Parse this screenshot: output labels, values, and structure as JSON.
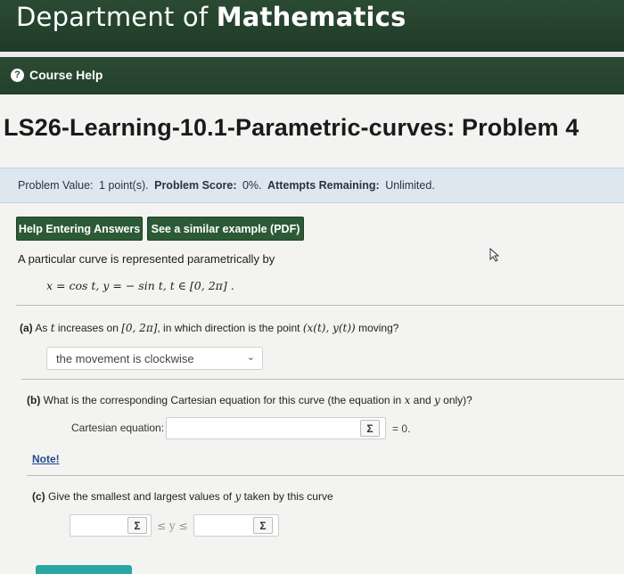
{
  "header": {
    "title_prefix": "Department of ",
    "title_bold": "Mathematics"
  },
  "nav": {
    "help_icon_glyph": "?",
    "course_help": "Course Help"
  },
  "page_title": "LS26-Learning-10.1-Parametric-curves: Problem 4",
  "info": {
    "value_label": "Problem Value:",
    "value_text": "1 point(s).",
    "score_label": "Problem Score:",
    "score_text": "0%.",
    "attempts_label": "Attempts Remaining:",
    "attempts_text": "Unlimited."
  },
  "buttons": {
    "help_entering": "Help Entering Answers",
    "similar_example": "See a similar example (PDF)"
  },
  "problem": {
    "intro": "A particular curve is represented parametrically by",
    "equation": "x = cos t,    y = − sin t,    t ∈ [0, 2π] ."
  },
  "part_a": {
    "label": "(a)",
    "text_1": " As ",
    "var_t": "t",
    "text_2": " increases on ",
    "interval": "[0, 2π]",
    "text_3": ", in which direction is the point ",
    "point": "(x(t), y(t))",
    "text_4": " moving?",
    "selected_option": "the movement is clockwise",
    "chevron": "⌄"
  },
  "part_b": {
    "label": "(b)",
    "text_1": " What is the corresponding Cartesian equation for this curve (the equation in ",
    "var_x": "x",
    "text_2": " and ",
    "var_y": "y",
    "text_3": " only)?",
    "field_label": "Cartesian equation:",
    "sigma": "Σ",
    "rhs": "= 0."
  },
  "note": "Note!",
  "part_c": {
    "label": "(c)",
    "text_1": " Give the smallest and largest values of ",
    "var_y": "y",
    "text_2": " taken by this curve",
    "sigma": "Σ",
    "between": "≤ y ≤"
  },
  "colors": {
    "header_bg": "#2b4a33",
    "button_bg": "#2c5a36",
    "info_bg": "#dde7f0",
    "link": "#1f4a8c"
  }
}
